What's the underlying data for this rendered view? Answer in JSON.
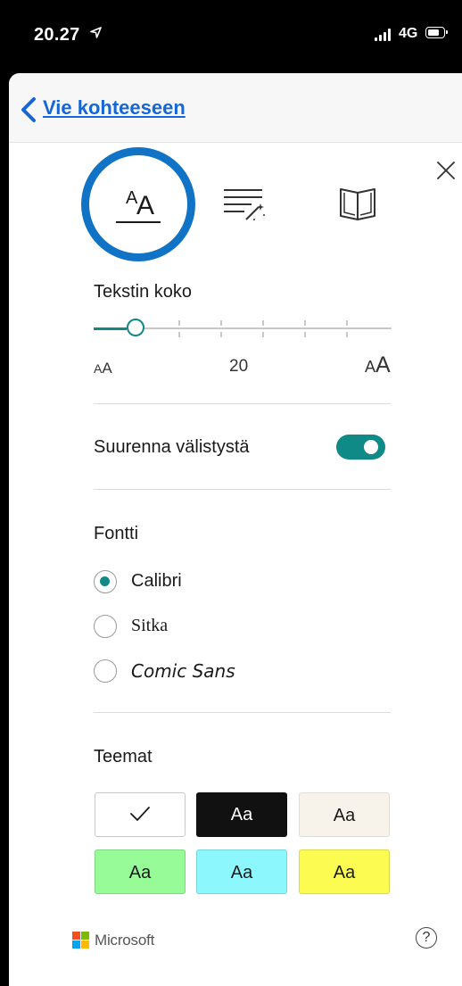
{
  "status_bar": {
    "time": "20.27",
    "network": "4G",
    "icons": [
      "location-arrow-icon",
      "signal-icon",
      "battery-icon"
    ]
  },
  "nav": {
    "back_label": "Vie kohteeseen",
    "back_icon": "chevron-left-icon"
  },
  "tabs": [
    {
      "name": "text-preferences",
      "icon": "text-size-icon",
      "selected": true
    },
    {
      "name": "grammar-options",
      "icon": "grammar-icon",
      "selected": false
    },
    {
      "name": "reading-preferences",
      "icon": "book-icon",
      "selected": false
    }
  ],
  "text_size": {
    "label": "Tekstin koko",
    "value": "20",
    "small_label_small": "A",
    "small_label_big": "A",
    "large_label_small": "A",
    "large_label_big": "A",
    "slider_fraction": 0.14
  },
  "spacing": {
    "label": "Suurenna välistystä",
    "enabled": true
  },
  "font": {
    "label": "Fontti",
    "options": [
      "Calibri",
      "Sitka",
      "Comic Sans"
    ],
    "selected": "Calibri"
  },
  "themes": {
    "label": "Teemat",
    "items": [
      {
        "label": "",
        "bg": "#ffffff",
        "fg": "#1a1a1a",
        "selected": true
      },
      {
        "label": "Aa",
        "bg": "#111111",
        "fg": "#ffffff",
        "selected": false
      },
      {
        "label": "Aa",
        "bg": "#f7f3ea",
        "fg": "#1a1a1a",
        "selected": false
      },
      {
        "label": "Aa",
        "bg": "#97fb98",
        "fg": "#1a1a1a",
        "selected": false
      },
      {
        "label": "Aa",
        "bg": "#8cf8fd",
        "fg": "#1a1a1a",
        "selected": false
      },
      {
        "label": "Aa",
        "bg": "#fbfb52",
        "fg": "#1a1a1a",
        "selected": false
      }
    ]
  },
  "footer": {
    "brand": "Microsoft",
    "help_label": "?"
  },
  "colors": {
    "accent": "#0f8a87",
    "tab_ring": "#1073c6",
    "link": "#1566d6"
  }
}
